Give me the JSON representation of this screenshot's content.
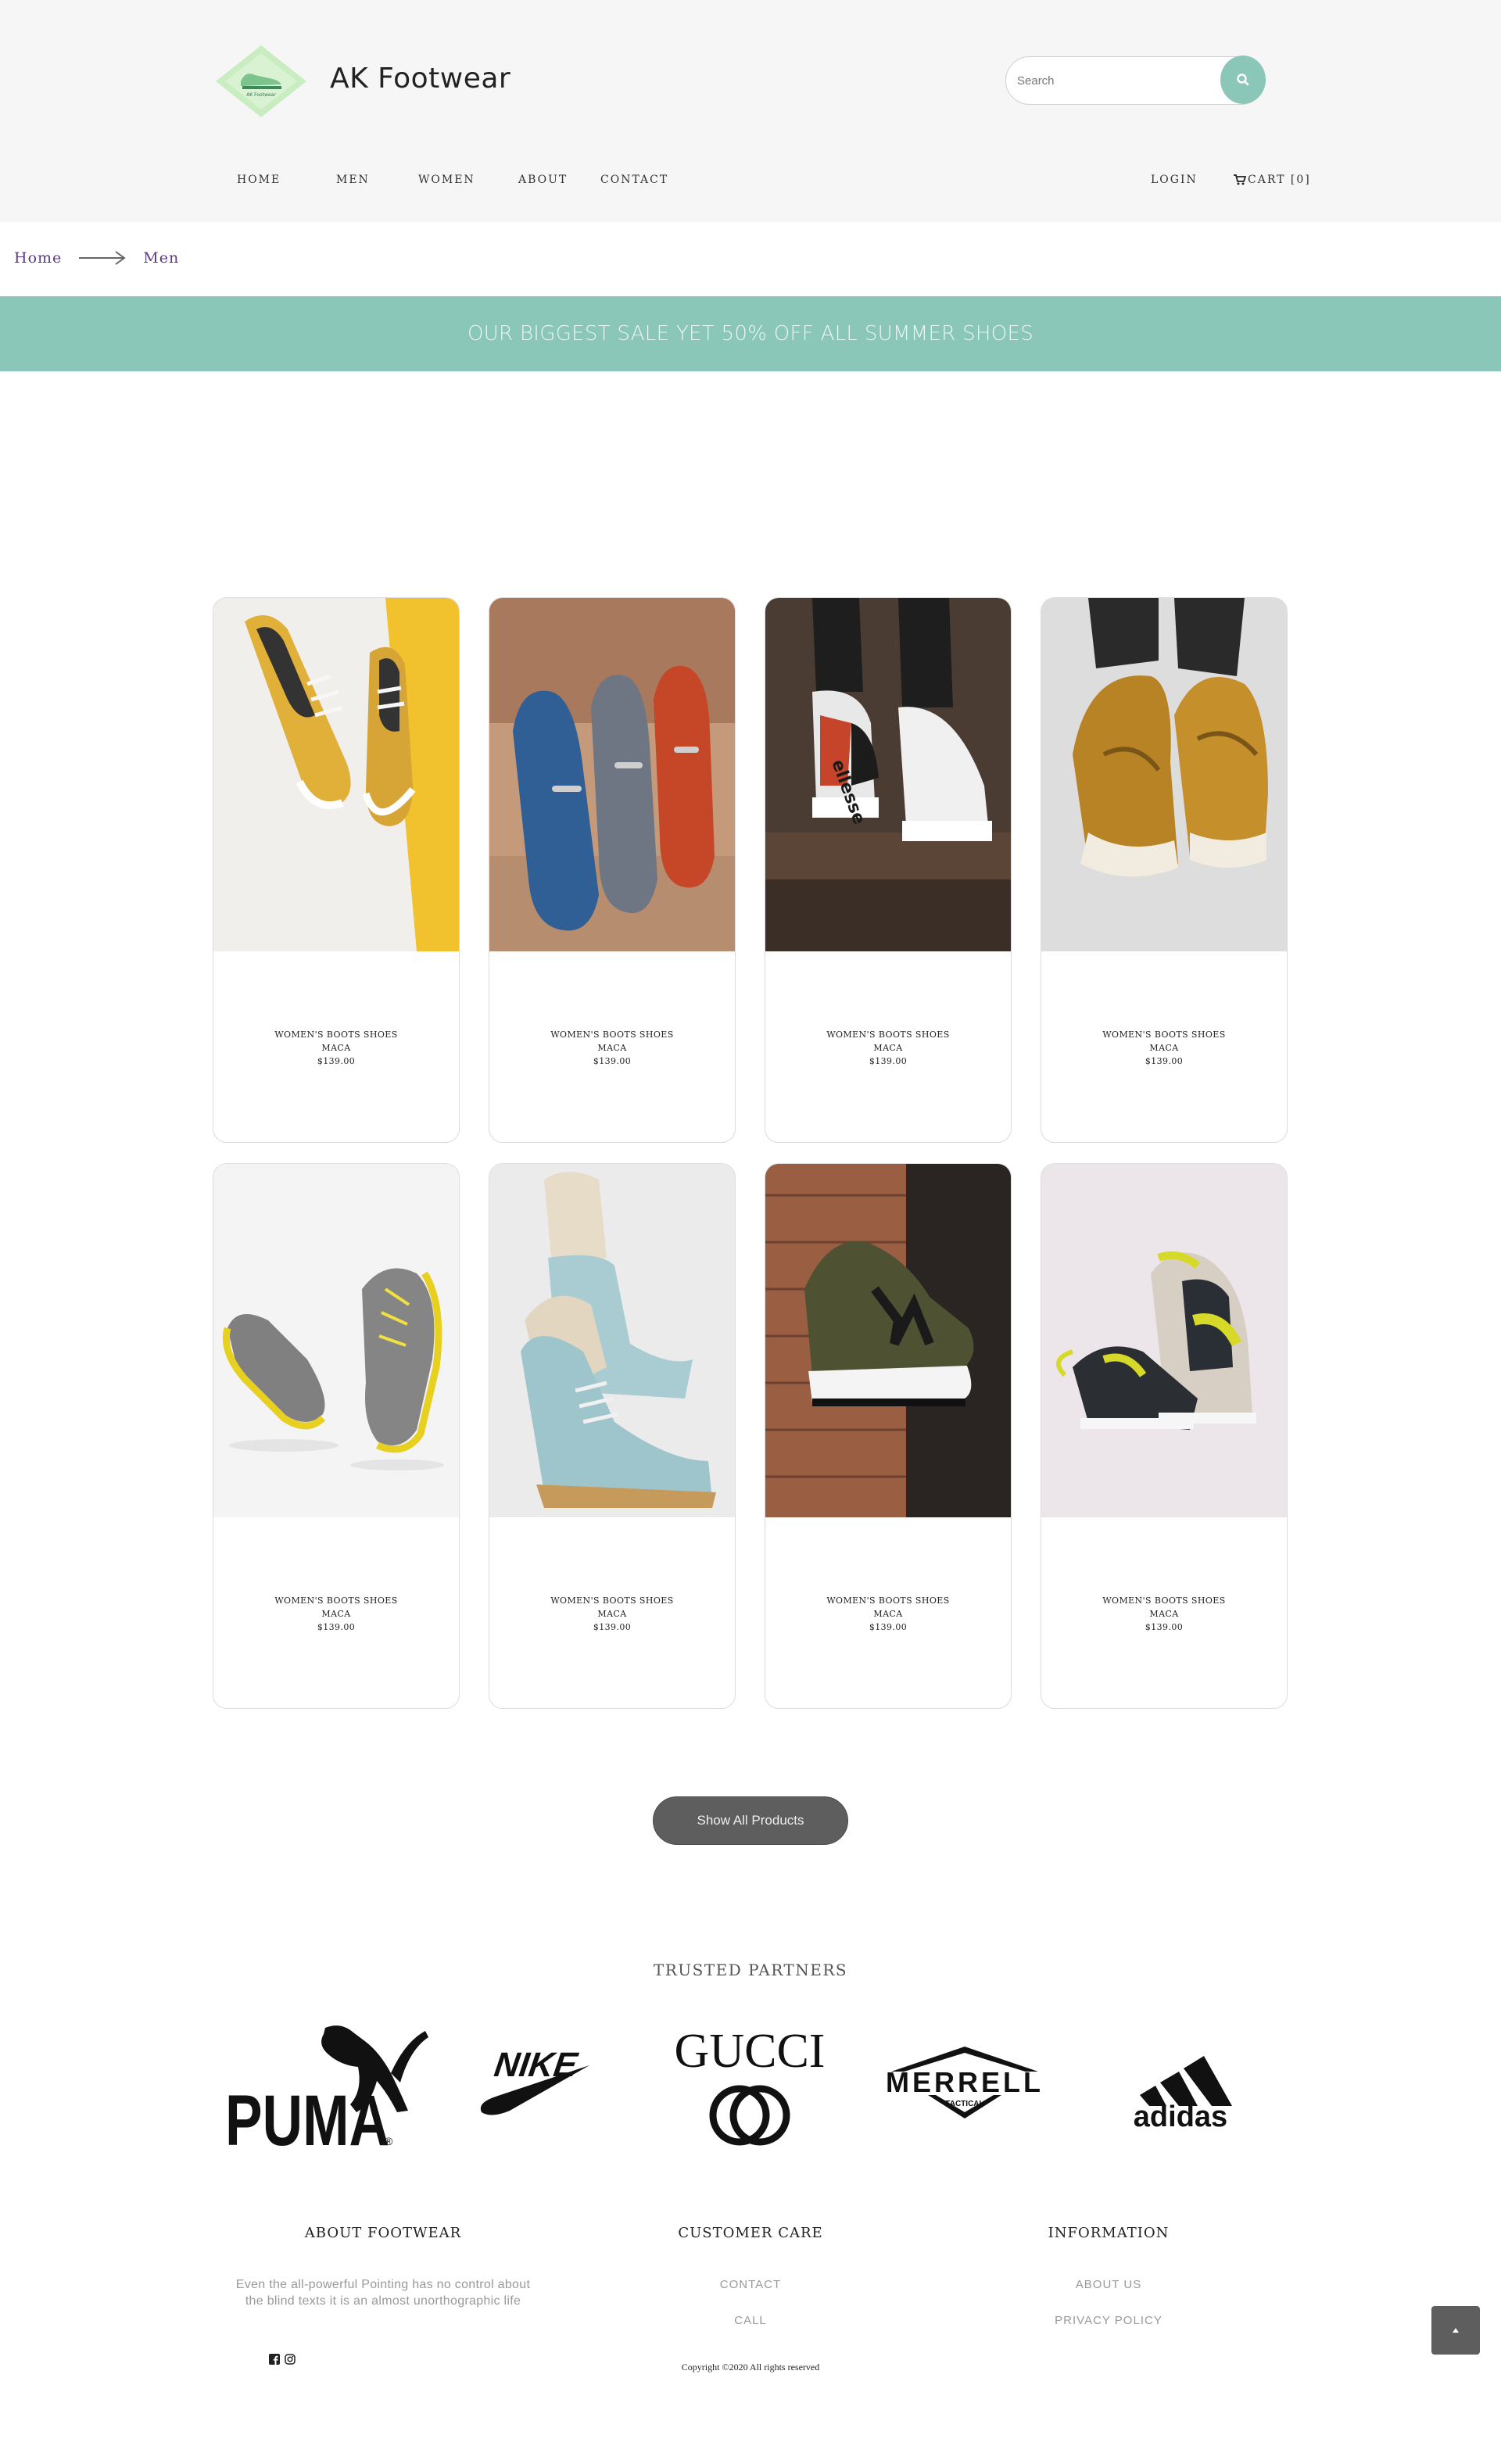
{
  "header": {
    "brand": "AK Footwear",
    "search_placeholder": "Search",
    "nav": {
      "home": "HOME",
      "men": "MEN",
      "women": "WOMEN",
      "about": "ABOUT",
      "contact": "CONTACT",
      "login": "LOGIN",
      "cart": "CART [0]"
    }
  },
  "breadcrumb": {
    "home": "Home",
    "current": "Men"
  },
  "banner": "OUR BIGGEST SALE YET 50% OFF ALL SUMMER SHOES",
  "products": [
    {
      "name": "WOMEN'S BOOTS SHOES",
      "sub": "MACA",
      "price": "$139.00"
    },
    {
      "name": "WOMEN'S BOOTS SHOES",
      "sub": "MACA",
      "price": "$139.00"
    },
    {
      "name": "WOMEN'S BOOTS SHOES",
      "sub": "MACA",
      "price": "$139.00"
    },
    {
      "name": "WOMEN'S BOOTS SHOES",
      "sub": "MACA",
      "price": "$139.00"
    },
    {
      "name": "WOMEN'S BOOTS SHOES",
      "sub": "MACA",
      "price": "$139.00"
    },
    {
      "name": "WOMEN'S BOOTS SHOES",
      "sub": "MACA",
      "price": "$139.00"
    },
    {
      "name": "WOMEN'S BOOTS SHOES",
      "sub": "MACA",
      "price": "$139.00"
    },
    {
      "name": "WOMEN'S BOOTS SHOES",
      "sub": "MACA",
      "price": "$139.00"
    }
  ],
  "show_all": "Show All Products",
  "partners": {
    "title": "TRUSTED PARTNERS",
    "logos": [
      "PUMA",
      "NIKE",
      "GUCCI",
      "MERRELL",
      "adidas"
    ],
    "merrell_sub": "TACTICAL"
  },
  "footer": {
    "about_title": "ABOUT FOOTWEAR",
    "about_text": "Even the all-powerful Pointing has no control about the blind texts it is an almost unorthographic life",
    "care_title": "CUSTOMER CARE",
    "care_links": [
      "CONTACT",
      "CALL"
    ],
    "info_title": "INFORMATION",
    "info_links": [
      "ABOUT US",
      "PRIVACY POLICY"
    ],
    "copyright": "Copyright ©2020 All rights reserved"
  },
  "colors": {
    "accent": "#8bc7b8",
    "breadcrumb": "#5c3b86",
    "button": "#5e5e5e"
  }
}
